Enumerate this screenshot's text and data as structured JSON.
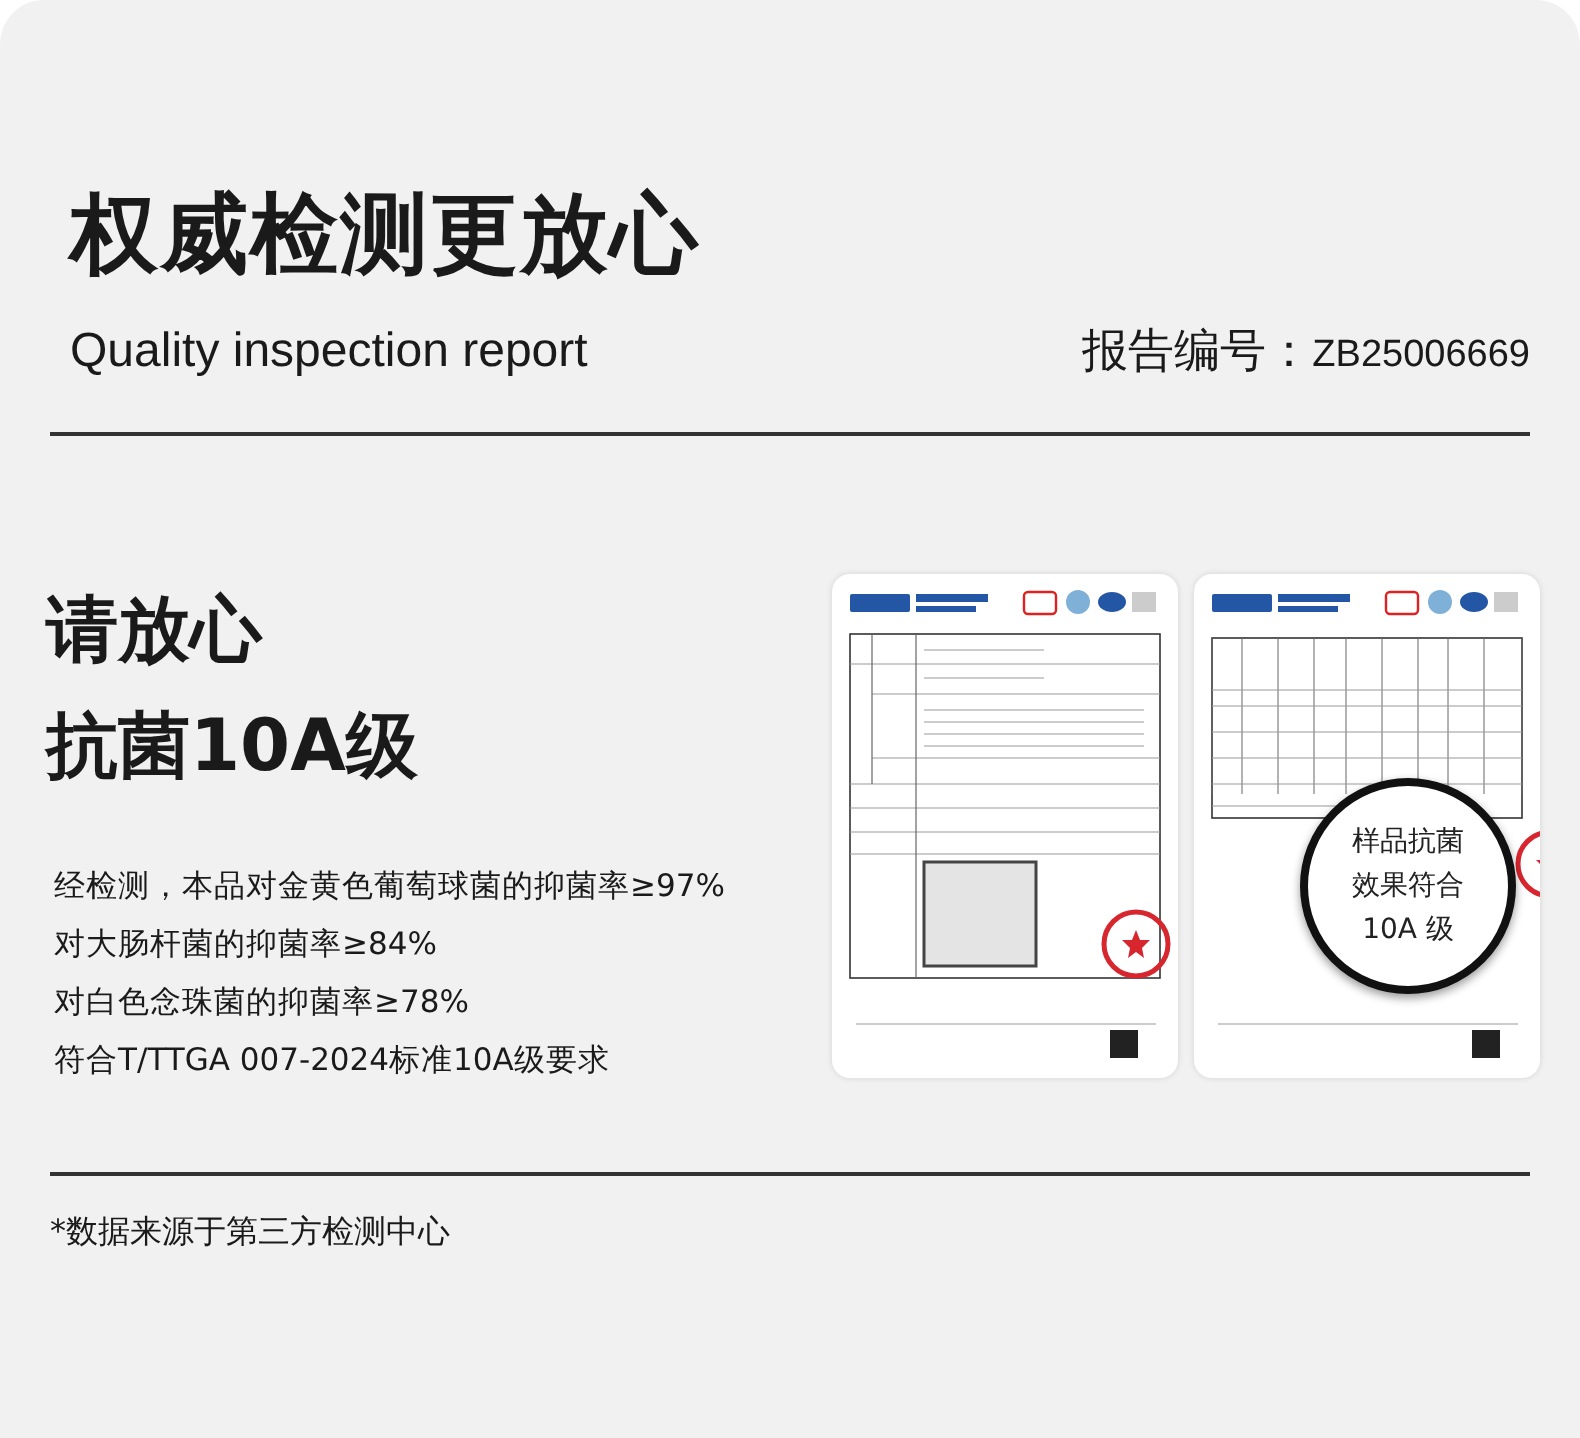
{
  "header": {
    "title": "权威检测更放心",
    "subtitle": "Quality inspection report",
    "report_label": "报告编号：",
    "report_number": "ZB25006669"
  },
  "claim": [
    "请放心",
    "抗菌10A级"
  ],
  "results": [
    "经检测，本品对金黄色葡萄球菌的抑菌率≥97%",
    "对大肠杆菌的抑菌率≥84%",
    "对白色念珠菌的抑菌率≥78%",
    "符合T/TTGA 007-2024标准10A级要求"
  ],
  "reports": [
    {
      "kind": "form"
    },
    {
      "kind": "table",
      "magnifier": [
        "样品抗菌",
        "效果符合",
        "10A 级"
      ]
    }
  ],
  "footnote": "*数据来源于第三方检测中心"
}
